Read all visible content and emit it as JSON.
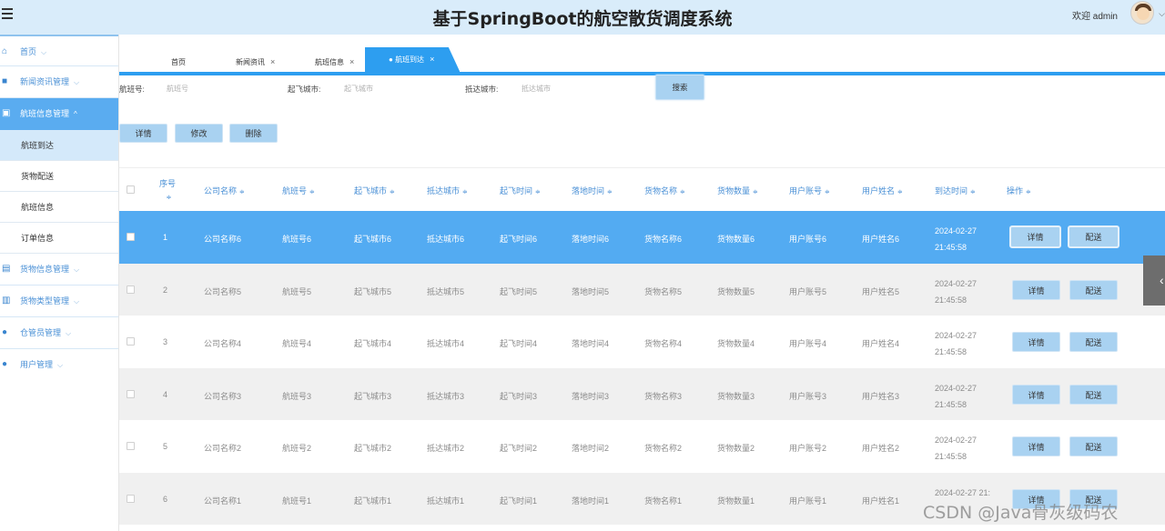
{
  "header": {
    "title": "基于SpringBoot的航空散货调度系统",
    "welcome": "欢迎 admin"
  },
  "sidebar": {
    "items": [
      {
        "label": "首页",
        "icon": "home-icon"
      },
      {
        "label": "新闻资讯管理",
        "icon": "news-icon"
      },
      {
        "label": "航班信息管理",
        "icon": "flight-icon",
        "active": true
      },
      {
        "label": "货物信息管理",
        "icon": "cargo-icon"
      },
      {
        "label": "货物类型管理",
        "icon": "type-icon"
      },
      {
        "label": "仓管员管理",
        "icon": "staff-icon"
      },
      {
        "label": "用户管理",
        "icon": "user-icon"
      }
    ],
    "sub_items": [
      "航班到达",
      "货物配送",
      "航班信息",
      "订单信息"
    ]
  },
  "tabs": [
    "首页",
    "新闻资讯",
    "航班信息",
    "航班到达"
  ],
  "search": {
    "flight_label": "航班号:",
    "flight_placeholder": "航班号",
    "depart_label": "起飞城市:",
    "depart_placeholder": "起飞城市",
    "arrive_label": "抵达城市:",
    "arrive_placeholder": "抵达城市",
    "button": "搜索"
  },
  "actions": {
    "detail": "详情",
    "edit": "修改",
    "delete": "删除"
  },
  "table": {
    "columns": [
      "序号",
      "公司名称",
      "航班号",
      "起飞城市",
      "抵达城市",
      "起飞时间",
      "落地时间",
      "货物名称",
      "货物数量",
      "用户账号",
      "用户姓名",
      "到达时间",
      "操作"
    ],
    "rows": [
      [
        "1",
        "公司名称6",
        "航班号6",
        "起飞城市6",
        "抵达城市6",
        "起飞时间6",
        "落地时间6",
        "货物名称6",
        "货物数量6",
        "用户账号6",
        "用户姓名6",
        "2024-02-27 21:45:58"
      ],
      [
        "2",
        "公司名称5",
        "航班号5",
        "起飞城市5",
        "抵达城市5",
        "起飞时间5",
        "落地时间5",
        "货物名称5",
        "货物数量5",
        "用户账号5",
        "用户姓名5",
        "2024-02-27 21:45:58"
      ],
      [
        "3",
        "公司名称4",
        "航班号4",
        "起飞城市4",
        "抵达城市4",
        "起飞时间4",
        "落地时间4",
        "货物名称4",
        "货物数量4",
        "用户账号4",
        "用户姓名4",
        "2024-02-27 21:45:58"
      ],
      [
        "4",
        "公司名称3",
        "航班号3",
        "起飞城市3",
        "抵达城市3",
        "起飞时间3",
        "落地时间3",
        "货物名称3",
        "货物数量3",
        "用户账号3",
        "用户姓名3",
        "2024-02-27 21:45:58"
      ],
      [
        "5",
        "公司名称2",
        "航班号2",
        "起飞城市2",
        "抵达城市2",
        "起飞时间2",
        "落地时间2",
        "货物名称2",
        "货物数量2",
        "用户账号2",
        "用户姓名2",
        "2024-02-27 21:45:58"
      ],
      [
        "6",
        "公司名称1",
        "航班号1",
        "起飞城市1",
        "抵达城市1",
        "起飞时间1",
        "落地时间1",
        "货物名称1",
        "货物数量1",
        "用户账号1",
        "用户姓名1",
        "2024-02-27 21:"
      ]
    ],
    "row_buttons": {
      "detail": "详情",
      "deliver": "配送"
    }
  },
  "watermark": "CSDN @Java骨灰级码农",
  "colors": {
    "accent": "#2d9ef0",
    "selected_row": "#53abf2",
    "button": "#a9d2f1",
    "header_bg": "#d9ecfa"
  }
}
